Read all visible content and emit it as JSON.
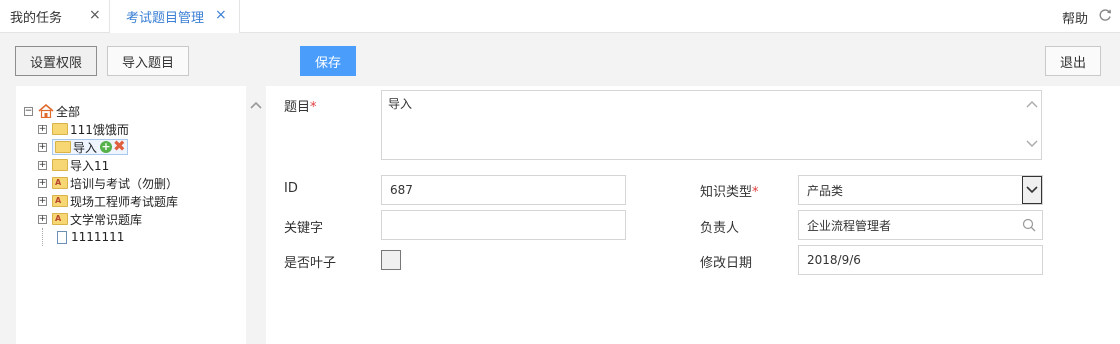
{
  "tabs": [
    {
      "label": "我的任务",
      "close": "×"
    },
    {
      "label": "考试题目管理",
      "close": "×"
    }
  ],
  "header": {
    "help": "帮助"
  },
  "toolbar": {
    "perm_label": "设置权限",
    "import_label": "导入题目",
    "save_label": "保存",
    "quit_label": "退出"
  },
  "tree": {
    "root": "全部",
    "items": [
      {
        "label": "111饿饿而",
        "type": "folder",
        "expand": "+"
      },
      {
        "label": "导入",
        "type": "folder",
        "expand": "+",
        "selected": true
      },
      {
        "label": "导入11",
        "type": "folder",
        "expand": "+"
      },
      {
        "label": "培训与考试（勿删）",
        "type": "folder-a",
        "expand": "+"
      },
      {
        "label": "现场工程师考试题库",
        "type": "folder-a",
        "expand": "+"
      },
      {
        "label": "文学常识题库",
        "type": "folder-a",
        "expand": "+"
      },
      {
        "label": "1111111",
        "type": "doc"
      }
    ],
    "root_expand": "−",
    "folder_badge": "A",
    "add_glyph": "+",
    "delete_glyph": "✖"
  },
  "form": {
    "title_label": "题目",
    "required_mark": "*",
    "title_value": "导入",
    "id_label": "ID",
    "id_value": "687",
    "keyword_label": "关键字",
    "keyword_value": "",
    "leaf_label": "是否叶子",
    "knowledge_label": "知识类型",
    "knowledge_value": "产品类",
    "owner_label": "负责人",
    "owner_value": "企业流程管理者",
    "modified_label": "修改日期",
    "modified_value": "2018/9/6"
  },
  "colors": {
    "accent": "#4a9dfb",
    "tab_active": "#3a7fd5",
    "required": "#e03c3c"
  }
}
